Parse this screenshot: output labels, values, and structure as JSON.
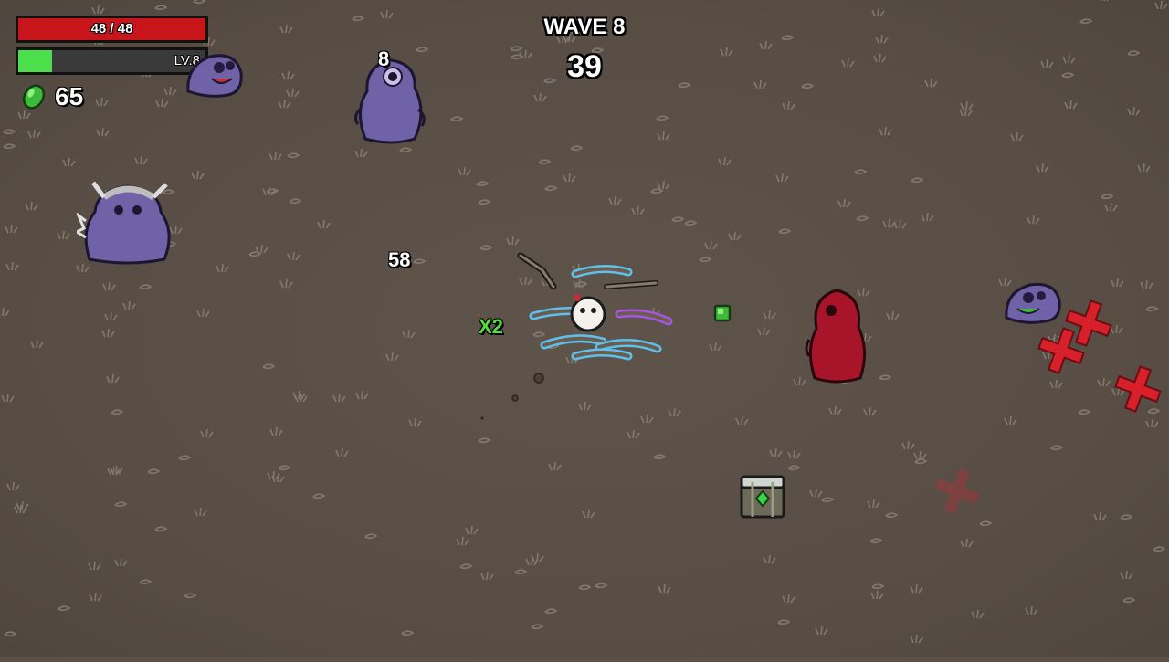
{
  "hud": {
    "health": {
      "current": 48,
      "max": 48,
      "text": "48 / 48",
      "fill_fraction": 1.0,
      "color": "#c8141b"
    },
    "experience": {
      "level_text": "LV.8",
      "fill_fraction": 0.18,
      "color": "#4be04b"
    },
    "materials": {
      "icon": "material-icon",
      "count": "65"
    },
    "wave": {
      "title": "WAVE 8",
      "timer": "39"
    }
  },
  "floating_text": {
    "damage_a": "8",
    "damage_b": "58",
    "pickup_multiplier": "X2"
  },
  "entities": {
    "player": {
      "name": "player",
      "weapons": 8
    },
    "enemies": [
      {
        "type": "purple-baby-alien"
      },
      {
        "type": "purple-alien"
      },
      {
        "type": "horned-purple-alien"
      },
      {
        "type": "red-alien"
      },
      {
        "type": "purple-baby-alien"
      }
    ],
    "loot_crate": {
      "type": "loot-crate"
    },
    "material_drop": {
      "type": "material-drop"
    },
    "spawn_markers": 4
  },
  "colors": {
    "ground": "#5b5147",
    "enemy_purple": "#6f62a6",
    "enemy_red": "#a8152a",
    "spawn_marker": "#d8202a"
  }
}
